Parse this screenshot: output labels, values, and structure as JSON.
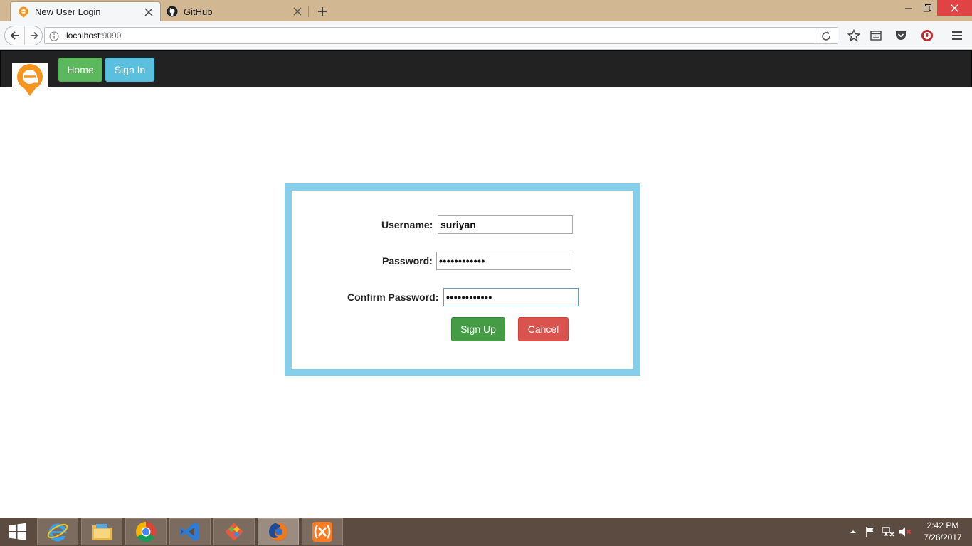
{
  "browser": {
    "tabs": [
      {
        "title": "New User Login",
        "active": true
      },
      {
        "title": "GitHub",
        "active": false
      }
    ],
    "url": {
      "host": "localhost",
      "port": ":9090"
    }
  },
  "app": {
    "nav": {
      "home_label": "Home",
      "signin_label": "Sign In"
    },
    "form": {
      "username_label": "Username:",
      "username_value": "suriyan",
      "password_label": "Password:",
      "password_value": "••••••••••••",
      "confirm_label": "Confirm Password:",
      "confirm_value": "••••••••••••",
      "signup_label": "Sign Up",
      "cancel_label": "Cancel"
    }
  },
  "taskbar": {
    "apps": [
      "internet-explorer-icon",
      "file-explorer-icon",
      "chrome-icon",
      "visual-studio-icon",
      "git-icon",
      "firefox-icon",
      "xampp-icon"
    ],
    "clock": {
      "time": "2:42 PM",
      "date": "7/26/2017"
    }
  },
  "colors": {
    "brand_orange": "#f7941d",
    "nav_bg": "#222222",
    "form_border": "#87ceeb",
    "success": "#5cb85c",
    "info": "#5bc0de",
    "danger": "#d9534f"
  }
}
